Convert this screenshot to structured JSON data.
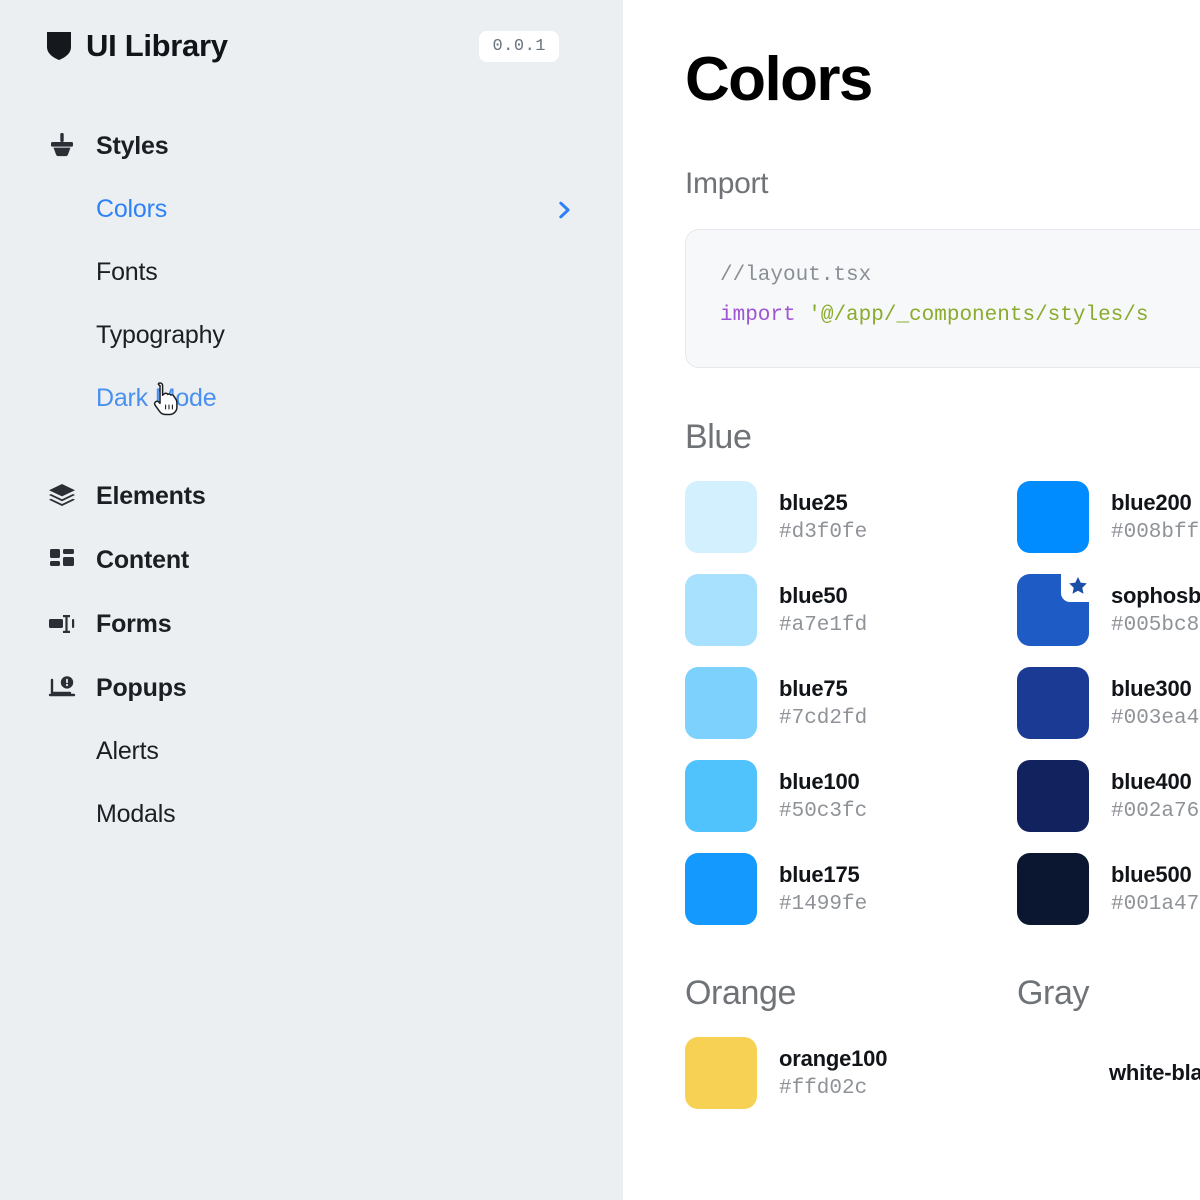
{
  "sidebar": {
    "brand": {
      "icon": "shield-icon",
      "title": "UI Library",
      "version": "0.0.1"
    },
    "groups": [
      {
        "label": "Styles",
        "icon": "paintbrush-icon",
        "items": [
          {
            "label": "Colors",
            "state": "active",
            "trailing_icon": "chevron-right-icon"
          },
          {
            "label": "Fonts",
            "state": "default"
          },
          {
            "label": "Typography",
            "state": "default"
          },
          {
            "label": "Dark Mode",
            "state": "hovered"
          }
        ]
      },
      {
        "label": "Elements",
        "icon": "layers-icon",
        "items": []
      },
      {
        "label": "Content",
        "icon": "grid-icon",
        "items": []
      },
      {
        "label": "Forms",
        "icon": "form-input-icon",
        "items": []
      },
      {
        "label": "Popups",
        "icon": "popup-notification-icon",
        "items": [
          {
            "label": "Alerts",
            "state": "default"
          },
          {
            "label": "Modals",
            "state": "default"
          }
        ]
      }
    ],
    "cursor": "pointer-hand-cursor"
  },
  "main": {
    "title": "Colors",
    "import": {
      "label": "Import",
      "comment": "//layout.tsx",
      "keyword": "import",
      "path": "'@/app/_components/styles/s"
    },
    "palettes": [
      {
        "name": "Blue",
        "columns": [
          {
            "swatches": [
              {
                "name": "blue25",
                "hex": "#d3f0fe"
              },
              {
                "name": "blue50",
                "hex": "#a7e1fd"
              },
              {
                "name": "blue75",
                "hex": "#7cd2fd"
              },
              {
                "name": "blue100",
                "hex": "#50c3fc"
              },
              {
                "name": "blue175",
                "hex": "#1499fe"
              }
            ]
          },
          {
            "swatches": [
              {
                "name": "blue200",
                "hex": "#008bff"
              },
              {
                "name": "sophosb",
                "hex": "#005bc8",
                "badge": "star-icon"
              },
              {
                "name": "blue300",
                "hex": "#003ea4"
              },
              {
                "name": "blue400",
                "hex": "#002a76"
              },
              {
                "name": "blue500",
                "hex": "#001a47"
              }
            ]
          }
        ]
      },
      {
        "name": "Orange",
        "columns": [
          {
            "swatches": [
              {
                "name": "orange100",
                "hex": "#ffd02c"
              }
            ]
          }
        ]
      },
      {
        "name": "Gray",
        "columns": [
          {
            "swatches": [
              {
                "name": "white-black",
                "hex": "",
                "wrap": true
              }
            ]
          }
        ]
      }
    ]
  },
  "theme": {
    "sidebar_bg": "#eceff1",
    "main_bg": "#ffffff",
    "accent": "#2f82f6",
    "text": "#1b1f24",
    "muted": "#6f7276"
  }
}
